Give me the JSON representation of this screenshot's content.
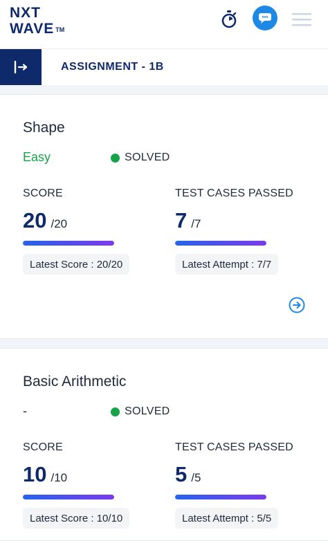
{
  "header": {
    "logo_line1": "NXT",
    "logo_line2": "WAVE",
    "logo_tm": "TM",
    "icons": [
      "timer-icon",
      "chat-icon",
      "menu-icon"
    ],
    "brand_color": "#0f2a6b",
    "accent_color": "#1e88e5"
  },
  "subheader": {
    "title": "ASSIGNMENT - 1B",
    "back_icon": "collapse-icon"
  },
  "questions": [
    {
      "title": "Shape",
      "difficulty": "Easy",
      "status": "SOLVED",
      "score_label": "SCORE",
      "score": "20",
      "score_total": "/20",
      "score_fraction": 1.0,
      "latest_score": "Latest Score : 20/20",
      "tests_label": "TEST CASES PASSED",
      "tests_passed": "7",
      "tests_total": "/7",
      "tests_fraction": 1.0,
      "latest_attempt": "Latest Attempt : 7/7"
    },
    {
      "title": "Basic Arithmetic",
      "difficulty": "-",
      "status": "SOLVED",
      "score_label": "SCORE",
      "score": "10",
      "score_total": "/10",
      "score_fraction": 1.0,
      "latest_score": "Latest Score : 10/10",
      "tests_label": "TEST CASES PASSED",
      "tests_passed": "5",
      "tests_total": "/5",
      "tests_fraction": 1.0,
      "latest_attempt": "Latest Attempt : 5/5"
    }
  ],
  "colors": {
    "solved": "#16a34a",
    "easy": "#16a34a",
    "progress_start": "#2563eb",
    "progress_end": "#7c3aed"
  }
}
